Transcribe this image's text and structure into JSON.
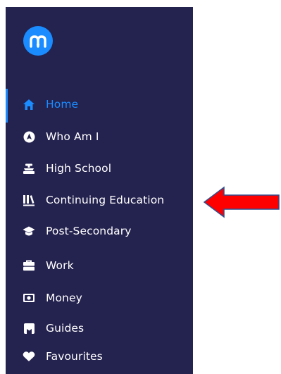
{
  "colors": {
    "sidebar_bg": "#24224f",
    "accent": "#1a8cff",
    "arrow": "#ff0000"
  },
  "logo": {
    "icon": "m-logo-icon"
  },
  "nav": {
    "items": [
      {
        "label": "Home",
        "icon": "home-icon",
        "active": true
      },
      {
        "label": "Who Am I",
        "icon": "compass-icon",
        "active": false
      },
      {
        "label": "High School",
        "icon": "school-icon",
        "active": false
      },
      {
        "label": "Continuing Education",
        "icon": "library-icon",
        "active": false
      },
      {
        "label": "Post-Secondary",
        "icon": "graduation-cap-icon",
        "active": false
      },
      {
        "label": "Work",
        "icon": "briefcase-icon",
        "active": false
      },
      {
        "label": "Money",
        "icon": "money-icon",
        "active": false
      },
      {
        "label": "Guides",
        "icon": "bookmark-icon",
        "active": false
      },
      {
        "label": "Favourites",
        "icon": "heart-icon",
        "active": false
      }
    ]
  },
  "annotation": {
    "icon": "left-arrow-icon",
    "points_to": "Continuing Education"
  }
}
